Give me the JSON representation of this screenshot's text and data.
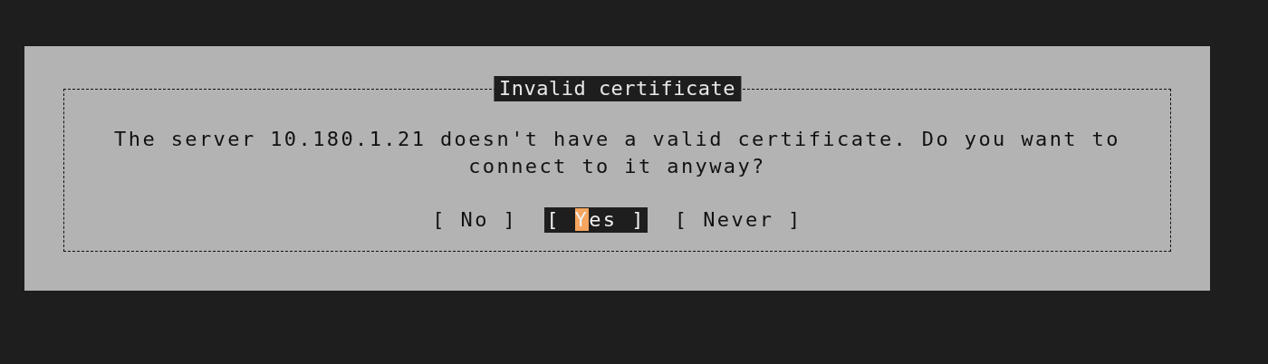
{
  "dialog": {
    "title": "Invalid certificate",
    "message": "The server 10.180.1.21 doesn't have a valid certificate. Do you want to connect to it anyway?",
    "buttons": [
      {
        "open": "[",
        "label": "No",
        "close": "]",
        "selected": false
      },
      {
        "open": "[",
        "label": "Yes",
        "close": "]",
        "selected": true
      },
      {
        "open": "[",
        "label": "Never",
        "close": "]",
        "selected": false
      }
    ]
  }
}
